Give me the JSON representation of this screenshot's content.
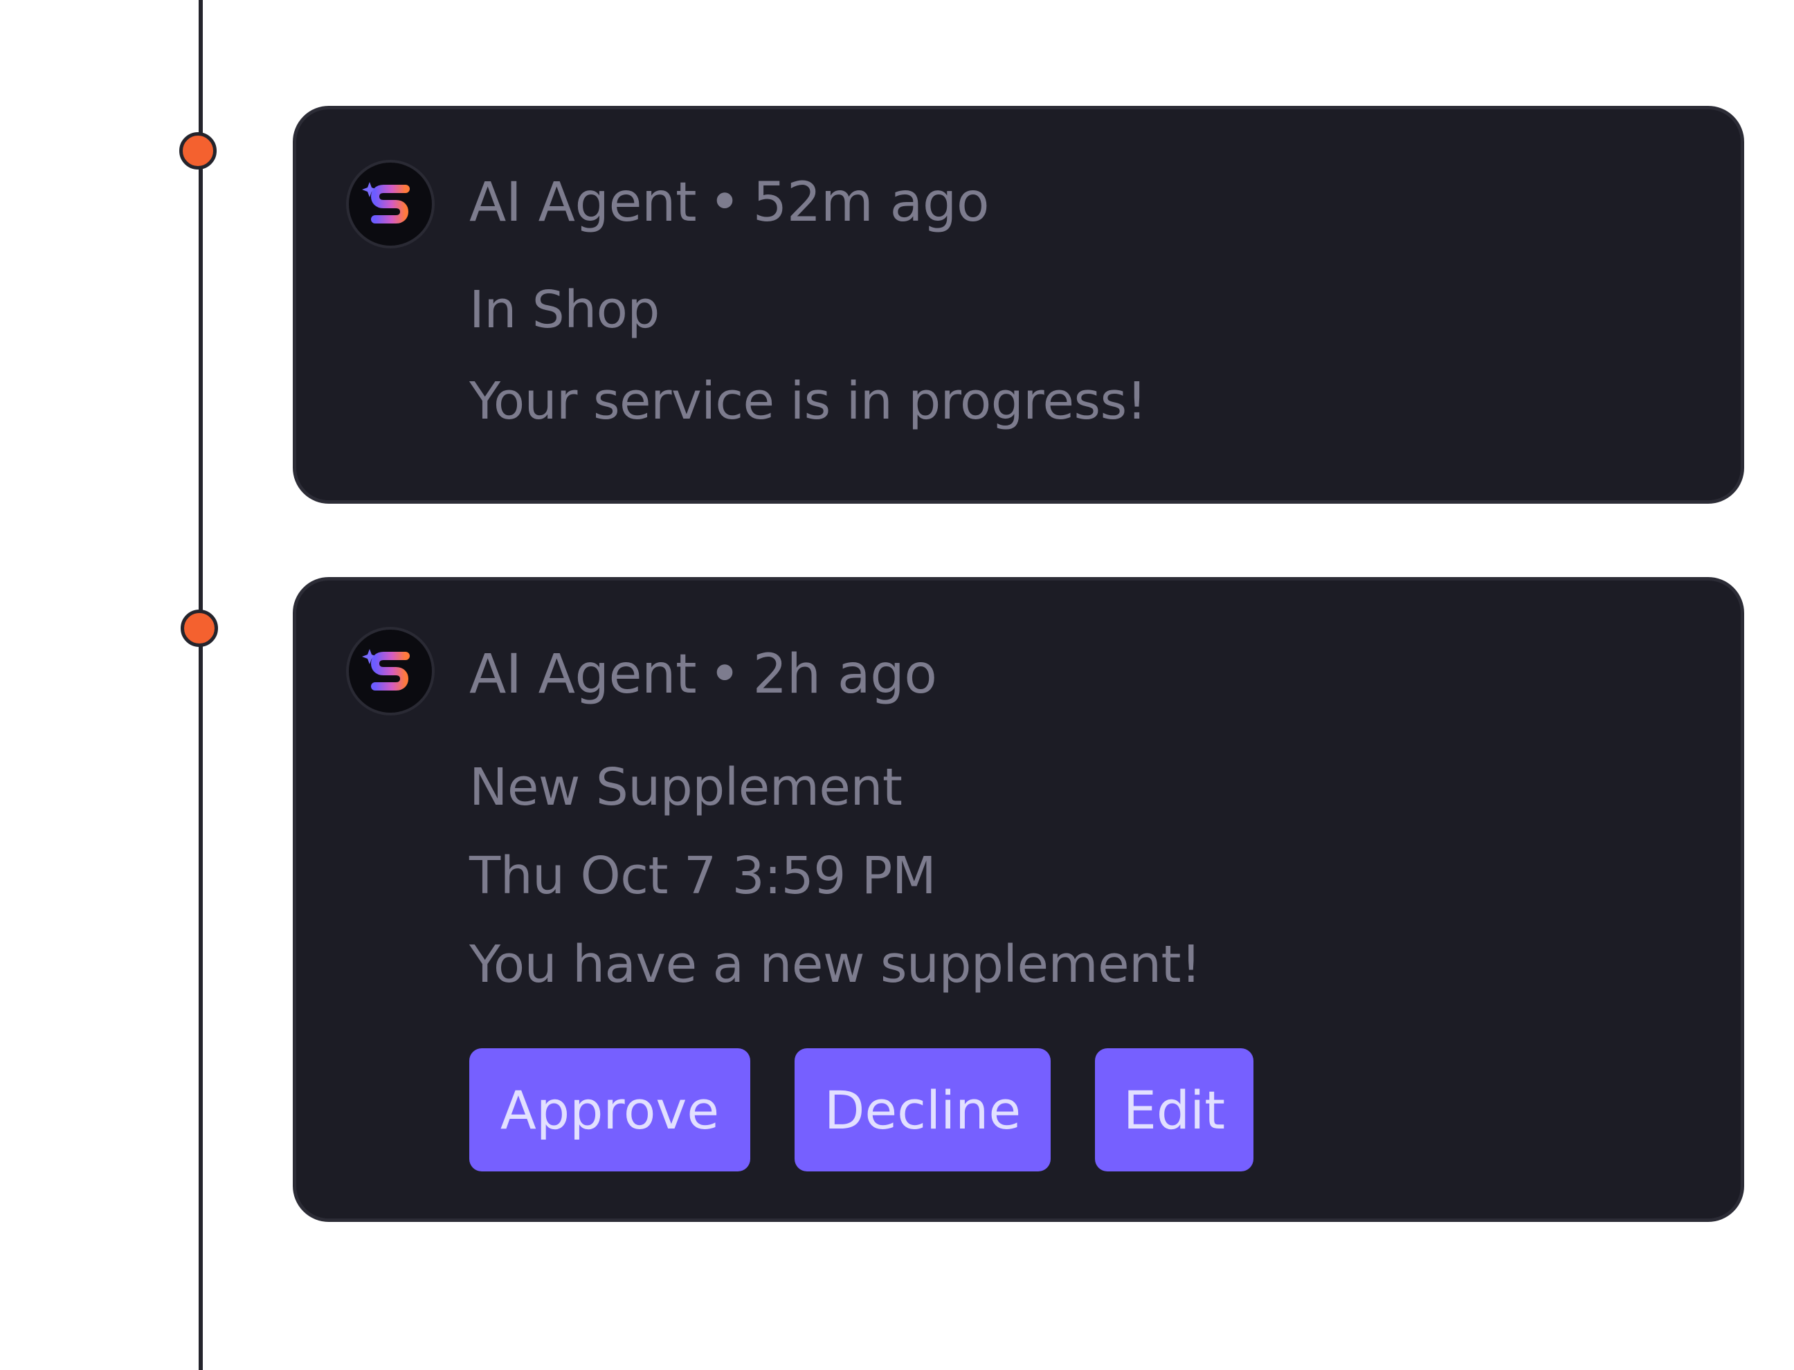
{
  "colors": {
    "accent_dot": "#f4612f",
    "timeline": "#24242c",
    "card_background": "#1c1c25",
    "text": "#7d7c8e",
    "button_background": "#7660ff",
    "button_text": "#e2e0ff"
  },
  "feed": [
    {
      "author": "AI Agent",
      "separator": "•",
      "time": "52m ago",
      "title": "In Shop",
      "message": "Your service is in progress!",
      "avatar_icon": "gradient-s-logo-icon"
    },
    {
      "author": "AI Agent",
      "separator": "•",
      "time": "2h ago",
      "title": "New Supplement",
      "date": "Thu Oct 7 3:59 PM",
      "message": "You have a new supplement!",
      "avatar_icon": "gradient-s-logo-icon",
      "actions": {
        "approve": "Approve",
        "decline": "Decline",
        "edit": "Edit"
      }
    }
  ]
}
